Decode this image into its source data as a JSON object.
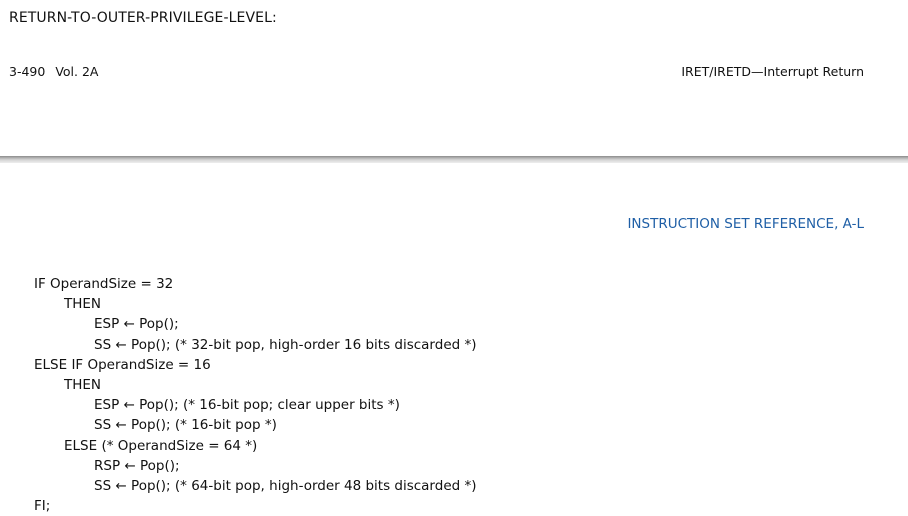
{
  "previous_page": {
    "section_heading": "RETURN-TO-OUTER-PRIVILEGE-LEVEL:",
    "footer": {
      "page_number": "3-490",
      "volume": "Vol. 2A",
      "instruction_title": "IRET/IRETD—Interrupt Return"
    }
  },
  "current_page": {
    "header": "INSTRUCTION SET REFERENCE, A-L",
    "code_lines": [
      {
        "indent": 0,
        "text": "IF OperandSize = 32"
      },
      {
        "indent": 1,
        "text": "THEN"
      },
      {
        "indent": 2,
        "text": "ESP ← Pop();"
      },
      {
        "indent": 2,
        "text": "SS ← Pop(); (* 32-bit pop, high-order 16 bits discarded *)"
      },
      {
        "indent": 0,
        "text": "ELSE IF OperandSize = 16"
      },
      {
        "indent": 1,
        "text": "THEN"
      },
      {
        "indent": 2,
        "text": "ESP ← Pop(); (* 16-bit pop; clear upper bits *)"
      },
      {
        "indent": 2,
        "text": "SS ← Pop(); (* 16-bit pop *)"
      },
      {
        "indent": 1,
        "text": "ELSE (* OperandSize = 64 *)"
      },
      {
        "indent": 2,
        "text": "RSP ← Pop();"
      },
      {
        "indent": 2,
        "text": "SS ← Pop(); (* 64-bit pop, high-order 48 bits discarded *)"
      },
      {
        "indent": 0,
        "text": "FI;"
      }
    ]
  },
  "colors": {
    "header_accent": "#1f5fa6",
    "text": "#111111"
  }
}
